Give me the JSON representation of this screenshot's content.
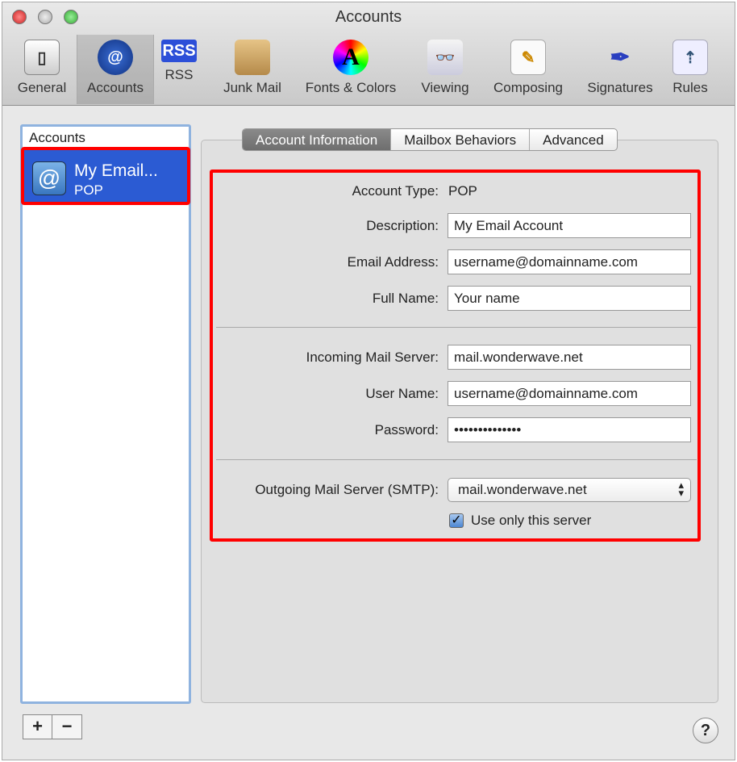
{
  "window": {
    "title": "Accounts"
  },
  "toolbar": [
    {
      "label": "General",
      "icon": "switch-icon"
    },
    {
      "label": "Accounts",
      "icon": "at-icon",
      "selected": true
    },
    {
      "label": "RSS",
      "icon": "rss-icon",
      "badge": "RSS"
    },
    {
      "label": "Junk Mail",
      "icon": "junk-bag-icon"
    },
    {
      "label": "Fonts & Colors",
      "icon": "font-color-icon",
      "badge": "A"
    },
    {
      "label": "Viewing",
      "icon": "glasses-icon"
    },
    {
      "label": "Composing",
      "icon": "pencil-paper-icon"
    },
    {
      "label": "Signatures",
      "icon": "pen-icon"
    },
    {
      "label": "Rules",
      "icon": "rules-arrows-icon"
    }
  ],
  "sidebar": {
    "header": "Accounts",
    "accounts": [
      {
        "name": "My Email...",
        "type": "POP",
        "icon_glyph": "@"
      }
    ],
    "add": "+",
    "remove": "−"
  },
  "tabs": [
    {
      "label": "Account Information",
      "selected": true
    },
    {
      "label": "Mailbox Behaviors"
    },
    {
      "label": "Advanced"
    }
  ],
  "form": {
    "account_type": {
      "label": "Account Type:",
      "value": "POP"
    },
    "description": {
      "label": "Description:",
      "value": "My Email Account"
    },
    "email": {
      "label": "Email Address:",
      "value": "username@domainname.com"
    },
    "full_name": {
      "label": "Full Name:",
      "value": "Your name"
    },
    "incoming": {
      "label": "Incoming Mail Server:",
      "value": "mail.wonderwave.net"
    },
    "user_name": {
      "label": "User Name:",
      "value": "username@domainname.com"
    },
    "password": {
      "label": "Password:",
      "value": "••••••••••••••"
    },
    "smtp": {
      "label": "Outgoing Mail Server (SMTP):",
      "value": "mail.wonderwave.net"
    },
    "use_only": {
      "label": "Use only this server",
      "checked": true
    }
  },
  "help": "?",
  "colors": {
    "highlight": "#f00",
    "selection": "#2b5bd3"
  }
}
